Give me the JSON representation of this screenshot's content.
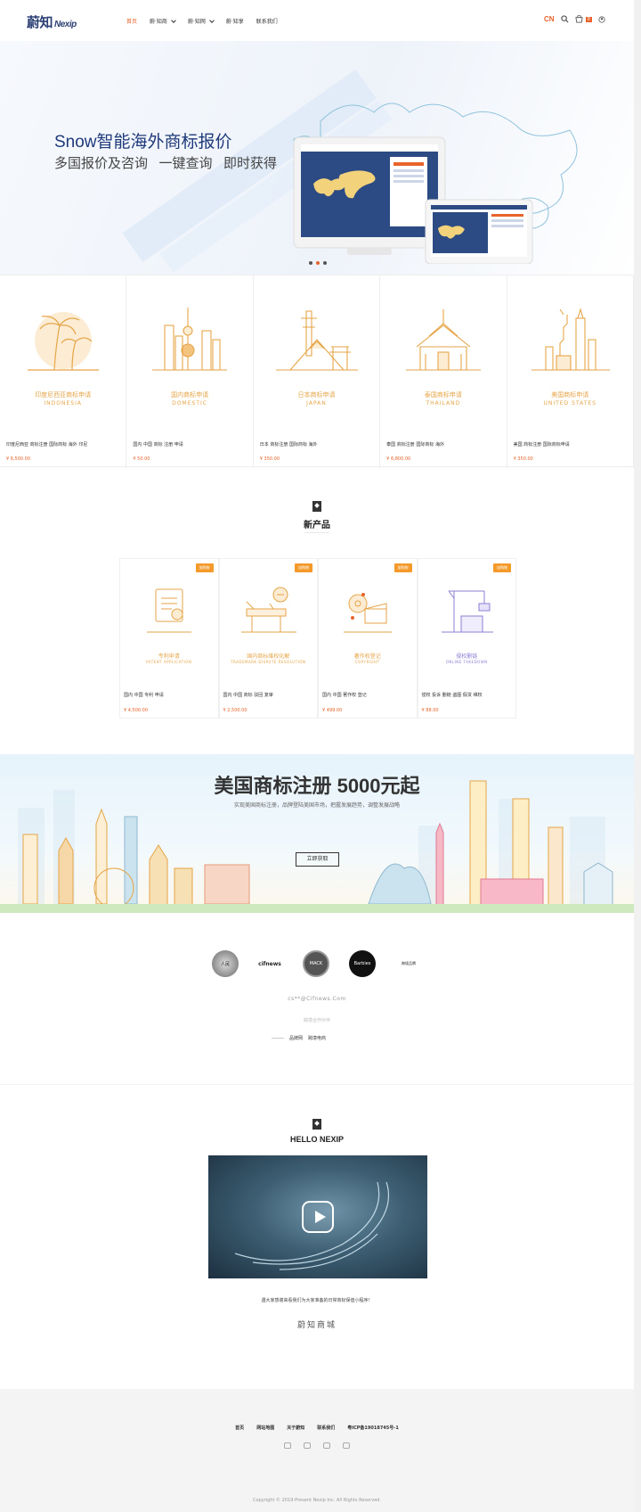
{
  "header": {
    "logo_text": "蔚知",
    "logo_sub": "Nexip",
    "nav": [
      {
        "label": "首页",
        "dropdown": false,
        "active": true
      },
      {
        "label": "蔚·知商",
        "dropdown": true,
        "active": false
      },
      {
        "label": "蔚·知网",
        "dropdown": true,
        "active": false
      },
      {
        "label": "蔚·知享",
        "dropdown": false,
        "active": false
      },
      {
        "label": "联系我们",
        "dropdown": false,
        "active": false
      }
    ],
    "lang": "CN",
    "cart_count": "0"
  },
  "hero": {
    "title": "Snow智能海外商标报价",
    "subtitle": "多国报价及咨询   一键查询   即时获得",
    "slides": 3,
    "active_slide": 2
  },
  "countries": [
    {
      "name": "印度尼西亚商标申请",
      "en": "INDONESIA",
      "desc": "印度尼西亚 商标注册 国际商标 海外 印尼",
      "price": "¥ 6,500.00"
    },
    {
      "name": "国内商标申请",
      "en": "DOMESTIC",
      "desc": "国内 中国 商标 注册 申请",
      "price": "¥ 50.00"
    },
    {
      "name": "日本商标申请",
      "en": "JAPAN",
      "desc": "日本 商标注册 国际商标 海外",
      "price": "¥ 350.00"
    },
    {
      "name": "泰国商标申请",
      "en": "THAILAND",
      "desc": "泰国 商标注册 国际商标 海外",
      "price": "¥ 6,800.00"
    },
    {
      "name": "美国商标申请",
      "en": "UNITED STATES",
      "desc": "美国 商标注册 国际商标申请",
      "price": "¥ 350.00"
    }
  ],
  "new_products": {
    "title": "新产品",
    "items": [
      {
        "tag": "加购物",
        "name": "专利申请",
        "en": "PATENT APPLICATION",
        "desc": "国内 中国 专利 申请",
        "price": "¥ 4,500.00"
      },
      {
        "tag": "加购物",
        "name": "国内商标维权化解",
        "en": "TRADEMARK DISPUTE RESOLUTION",
        "desc": "国内 中国 商标 驳回 复审",
        "price": "¥ 2,500.00"
      },
      {
        "tag": "加购物",
        "name": "著作权登记",
        "en": "COPYRIGHT",
        "desc": "国内 中国 著作权 登记",
        "price": "¥ 499.00"
      },
      {
        "tag": "加购物",
        "name": "侵权删链",
        "en": "ONLINE TAKEDOWN",
        "desc": "侵权 投诉 删链 盗图 假货 维权",
        "price": "¥ 88.00"
      }
    ]
  },
  "banner": {
    "title": "美国商标注册 5000元起",
    "subtitle": "实现美国商标注册，品牌登陆美国市场，把握发展趋势，调整发展战略",
    "button": "立即获取"
  },
  "partners": {
    "logos": [
      {
        "icon": "partner-logo-1",
        "label": "人民"
      },
      {
        "icon": "partner-logo-2",
        "label": "cifnews"
      },
      {
        "icon": "partner-logo-3",
        "label": "MACK"
      },
      {
        "icon": "partner-logo-4",
        "label": "Barbies"
      },
      {
        "icon": "partner-logo-5",
        "label": "跨境品牌"
      }
    ],
    "email": "cs**@Cifnews.Com",
    "tiny_text": "跨境合作伙伴",
    "links": [
      "品牌网",
      "跨境电商"
    ]
  },
  "hello": {
    "title": "HELLO NEXIP",
    "caption": "遇大家感谢来看我们为大家准备的日常商标保值小程序！",
    "signature": "蔚知商城"
  },
  "footer": {
    "links": [
      "首页",
      "网站地图",
      "关于蔚知",
      "联系我们",
      "粤ICP备19018745号-1"
    ],
    "copyright": "Copyright © 2019-Present Nexip Inc. All Rights Reserved."
  },
  "colors": {
    "accent": "#e8642b",
    "brand": "#2b3f73",
    "gold": "#e6a548"
  }
}
